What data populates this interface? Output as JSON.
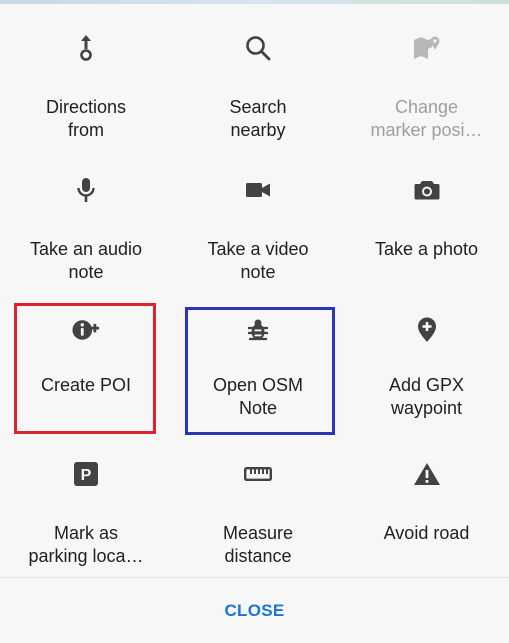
{
  "actions": [
    {
      "id": "directions-from",
      "label": "Directions\nfrom",
      "icon": "directions-from-icon",
      "disabled": false
    },
    {
      "id": "search-nearby",
      "label": "Search\nnearby",
      "icon": "search-icon",
      "disabled": false
    },
    {
      "id": "change-marker-position",
      "label": "Change\nmarker posi…",
      "icon": "map-marker-edit-icon",
      "disabled": true
    },
    {
      "id": "audio-note",
      "label": "Take an audio\nnote",
      "icon": "microphone-icon",
      "disabled": false
    },
    {
      "id": "video-note",
      "label": "Take a video\nnote",
      "icon": "video-camera-icon",
      "disabled": false
    },
    {
      "id": "take-photo",
      "label": "Take a photo",
      "icon": "camera-icon",
      "disabled": false
    },
    {
      "id": "create-poi",
      "label": "Create POI",
      "icon": "info-plus-icon",
      "disabled": false
    },
    {
      "id": "open-osm-note",
      "label": "Open OSM\nNote",
      "icon": "bug-icon",
      "disabled": false
    },
    {
      "id": "add-gpx-waypoint",
      "label": "Add GPX\nwaypoint",
      "icon": "waypoint-plus-icon",
      "disabled": false
    },
    {
      "id": "parking",
      "label": "Mark as\nparking loca…",
      "icon": "parking-icon",
      "disabled": false
    },
    {
      "id": "measure-distance",
      "label": "Measure\ndistance",
      "icon": "ruler-icon",
      "disabled": false
    },
    {
      "id": "avoid-road",
      "label": "Avoid road",
      "icon": "warning-icon",
      "disabled": false
    }
  ],
  "footer": {
    "close_label": "CLOSE"
  },
  "colors": {
    "icon": "#424242",
    "text": "#212121",
    "disabled": "#9e9e9e",
    "accent": "#1976d2",
    "highlight_red": "#e0222e",
    "highlight_blue": "#2b35b8"
  }
}
